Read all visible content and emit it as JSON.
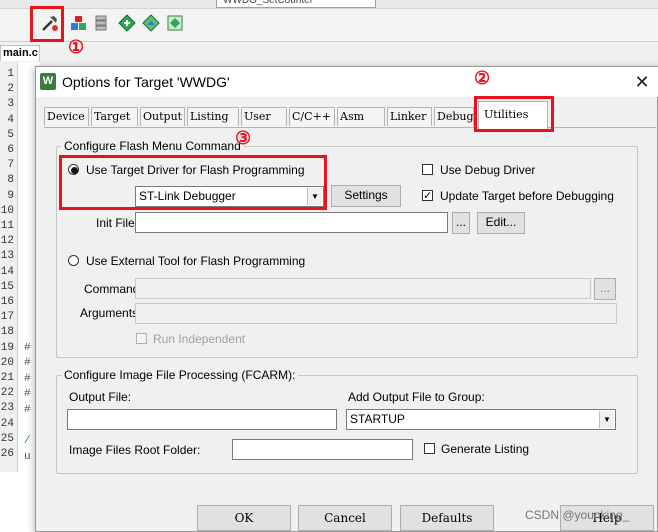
{
  "ide": {
    "top_combo": "WWDG_SetCounter",
    "file_tab": "main.c",
    "line_numbers": [
      "1",
      "2",
      "3",
      "4",
      "5",
      "6",
      "7",
      "8",
      "9",
      "10",
      "11",
      "12",
      "13",
      "14",
      "15",
      "16",
      "17",
      "18",
      "19",
      "20",
      "21",
      "22",
      "23",
      "24",
      "25",
      "26"
    ],
    "code_chars": [
      "#",
      "#",
      "#",
      "#",
      "#",
      "/",
      "u"
    ]
  },
  "annotations": {
    "n1": "①",
    "n2": "②",
    "n3": "③"
  },
  "dialog": {
    "icon": "W",
    "title": "Options for Target 'WWDG'",
    "close": "✕",
    "tabs": [
      "Device",
      "Target",
      "Output",
      "Listing",
      "User",
      "C/C++",
      "Asm",
      "Linker",
      "Debug",
      "Utilities"
    ],
    "active_tab": "Utilities"
  },
  "flash_group": {
    "label": "Configure Flash Menu Command",
    "use_target_driver": "Use Target Driver for Flash Programming",
    "driver_select": "ST-Link Debugger",
    "settings_button": "Settings",
    "use_debug_driver": "Use Debug Driver",
    "update_target": "Update Target before Debugging",
    "init_file_label": "Init File:",
    "init_file_value": "",
    "browse": "...",
    "edit_button": "Edit...",
    "use_external_tool": "Use External Tool for Flash Programming",
    "command_label": "Command:",
    "arguments_label": "Arguments:",
    "run_independent": "Run Independent"
  },
  "image_group": {
    "label": "Configure Image File Processing (FCARM):",
    "output_file_label": "Output File:",
    "add_output_label": "Add Output File  to Group:",
    "group_select": "STARTUP",
    "root_folder_label": "Image Files Root Folder:",
    "generate_listing": "Generate Listing"
  },
  "footer": {
    "ok": "OK",
    "cancel": "Cancel",
    "defaults": "Defaults",
    "help": "Help"
  },
  "watermark": "CSDN @younking_"
}
